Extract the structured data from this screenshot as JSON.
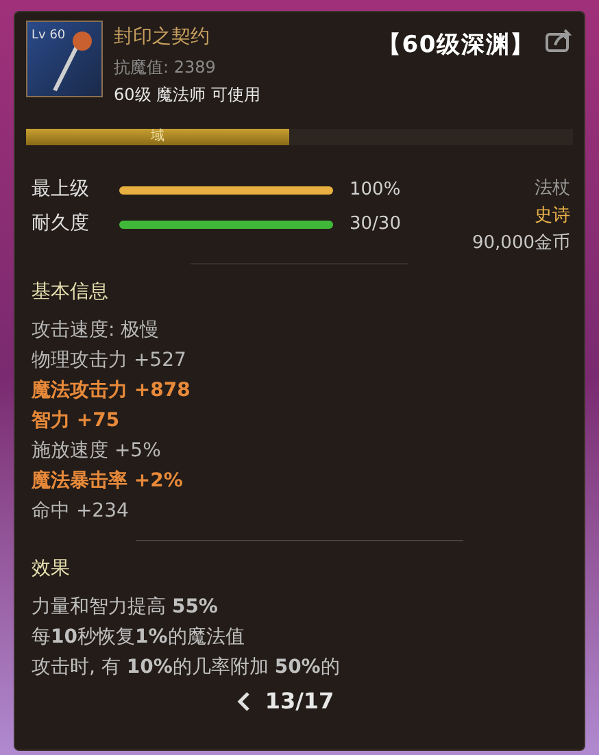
{
  "item": {
    "name": "封印之契约",
    "icon_badge": "Lv 60",
    "magic_resist": "抗魔值: 2389",
    "requirement": "60级 魔法师 可使用",
    "tag": "【60级深渊】"
  },
  "seal_bar": {
    "label": "域",
    "level": 0.48
  },
  "meters": [
    {
      "label": "最上级",
      "level": 1,
      "reading": "100%",
      "color": "#e8b040"
    },
    {
      "label": "耐久度",
      "level": 1,
      "reading": "30/30",
      "color": "#3fb83a"
    }
  ],
  "side_info": [
    {
      "text": "法杖",
      "color": "#9a9a9a"
    },
    {
      "text": "史诗",
      "color": "#e8b04a"
    },
    {
      "text": "90,000金币",
      "color": "#c8c8c8"
    }
  ],
  "basic_info": {
    "title": "基本信息",
    "lines": [
      {
        "text": "攻击速度: 极慢",
        "kind": "normal"
      },
      {
        "text": "物理攻击力 +527",
        "kind": "normal"
      },
      {
        "text": "魔法攻击力 +878",
        "kind": "highlight"
      },
      {
        "text": "智力 +75",
        "kind": "highlight"
      },
      {
        "text": "施放速度 +5%",
        "kind": "normal"
      },
      {
        "text": "魔法暴击率 +2%",
        "kind": "highlight"
      },
      {
        "text": "命中 +234",
        "kind": "normal"
      }
    ]
  },
  "effects": {
    "title": "效果",
    "lines": [
      "力量和智力提高 **55%**",
      "每**10**秒恢复**1%**的魔法值",
      "攻击时, 有 **10%**的几率附加 **50%**的"
    ]
  },
  "pager": {
    "text": "13/17"
  }
}
